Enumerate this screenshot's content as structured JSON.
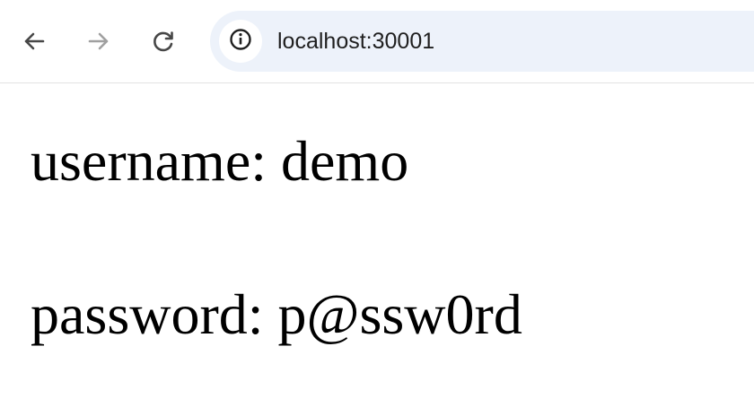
{
  "browser": {
    "back_icon": "arrow-left-icon",
    "forward_icon": "arrow-right-icon",
    "reload_icon": "reload-icon",
    "site_info_icon": "info-icon",
    "url": "localhost:30001",
    "colors": {
      "omnibox_bg": "#edf2fa",
      "icon_active": "#474747",
      "icon_disabled": "#a0a0a0"
    }
  },
  "page": {
    "username_line": "username: demo",
    "password_line": "password: p@ssw0rd"
  }
}
